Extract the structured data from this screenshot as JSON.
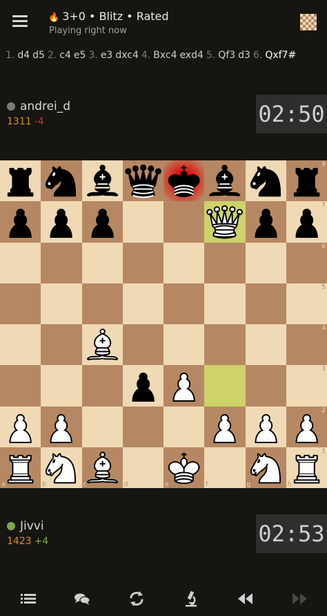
{
  "header": {
    "flame_glyph": "🔥",
    "title": "3+0 • Blitz • Rated",
    "subtitle": "Playing right now",
    "menu_icon": "hamburger-icon",
    "board_icon": "board-settings-icon"
  },
  "moves": [
    {
      "index": "1.",
      "white": "d4",
      "black": "d5"
    },
    {
      "index": "2.",
      "white": "c4",
      "black": "e5"
    },
    {
      "index": "3.",
      "white": "e3",
      "black": "dxc4"
    },
    {
      "index": "4.",
      "white": "Bxc4",
      "black": "exd4"
    },
    {
      "index": "5.",
      "white": "Qf3",
      "black": "d3"
    },
    {
      "index": "6.",
      "white": "Qxf7#",
      "black": ""
    }
  ],
  "current_move": "Qxf7#",
  "opponent": {
    "name": "andrei_d",
    "rating": "1311",
    "rating_diff": "-4",
    "status": "offline",
    "clock": "02:50"
  },
  "player": {
    "name": "Jivvi",
    "rating": "1423",
    "rating_diff": "+4",
    "status": "online",
    "clock": "02:53"
  },
  "board": {
    "ranks": [
      "8",
      "7",
      "6",
      "5",
      "4",
      "3",
      "2",
      "1"
    ],
    "files": [
      "a",
      "b",
      "c",
      "d",
      "e",
      "f",
      "g",
      "h"
    ],
    "position": [
      [
        "r",
        "n",
        "b",
        "q",
        "k",
        "b",
        "n",
        "r"
      ],
      [
        "p",
        "p",
        "p",
        "",
        "",
        "Q",
        "p",
        "p"
      ],
      [
        "",
        "",
        "",
        "",
        "",
        "",
        "",
        ""
      ],
      [
        "",
        "",
        "",
        "",
        "",
        "",
        "",
        ""
      ],
      [
        "",
        "",
        "B",
        "",
        "",
        "",
        "",
        ""
      ],
      [
        "",
        "",
        "",
        "p",
        "P",
        "",
        "",
        ""
      ],
      [
        "P",
        "P",
        "",
        "",
        "",
        "P",
        "P",
        "P"
      ],
      [
        "R",
        "N",
        "B",
        "",
        "K",
        "",
        "N",
        "R"
      ]
    ],
    "last_move": [
      "f3",
      "f7"
    ],
    "check_square": "e8",
    "light_color": "#f0d9b5",
    "dark_color": "#b58863"
  },
  "toolbar": [
    {
      "name": "moves-list-button",
      "icon": "list-icon"
    },
    {
      "name": "chat-button",
      "icon": "chat-icon"
    },
    {
      "name": "flip-board-button",
      "icon": "flip-icon"
    },
    {
      "name": "analysis-button",
      "icon": "microscope-icon"
    },
    {
      "name": "previous-move-button",
      "icon": "backward-icon"
    },
    {
      "name": "next-move-button",
      "icon": "forward-icon"
    }
  ]
}
